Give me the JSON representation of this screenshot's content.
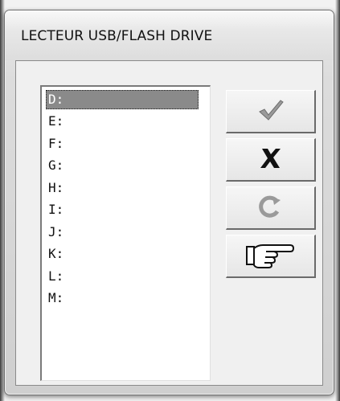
{
  "window": {
    "title": "LECTEUR USB/FLASH DRIVE"
  },
  "drive_list": {
    "items": [
      "D:",
      "E:",
      "F:",
      "G:",
      "H:",
      "I:",
      "J:",
      "K:",
      "L:",
      "M:"
    ],
    "selected": "D:"
  },
  "buttons": [
    {
      "name": "ok-button",
      "icon": "checkmark-icon",
      "enabled": false
    },
    {
      "name": "cancel-button",
      "icon": "x-icon",
      "enabled": true
    },
    {
      "name": "refresh-button",
      "icon": "refresh-icon",
      "enabled": false
    },
    {
      "name": "help-button",
      "icon": "pointing-hand-icon",
      "enabled": true
    }
  ],
  "colors": {
    "selection": "#8a8a8a",
    "disabled_icon": "#8c8c8c",
    "enabled_icon": "#111111"
  }
}
